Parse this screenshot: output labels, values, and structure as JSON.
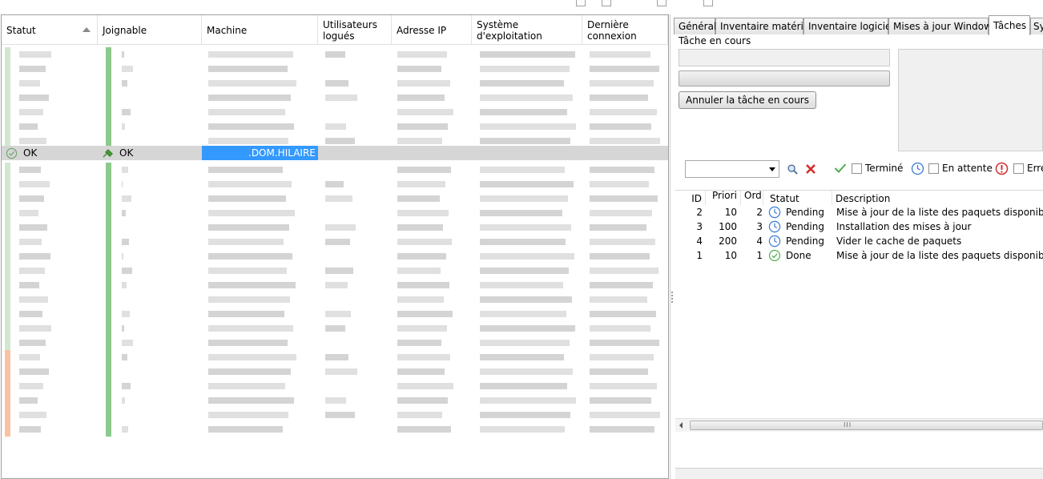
{
  "left_grid": {
    "columns": {
      "statut": "Statut",
      "joignable": "Joignable",
      "machine": "Machine",
      "utilisateurs": "Utilisateurs logués",
      "adresse_ip": "Adresse IP",
      "os": "Système d'exploitation",
      "derniere_connexion": "Dernière connexion"
    },
    "selected_row": {
      "statut": "OK",
      "joignable": "OK",
      "machine": ".DOM.HILAIRE"
    }
  },
  "tabs": [
    "Général",
    "Inventaire matériel",
    "Inventaire logiciel",
    "Mises à jour Windows",
    "Tâches",
    "Sy"
  ],
  "active_tab": "Tâches",
  "task_panel": {
    "current_task_label": "Tâche en cours",
    "cancel_button": "Annuler la tâche en cours"
  },
  "filters": {
    "done_label": "Terminé",
    "pending_label": "En attente",
    "error_label": "Erre"
  },
  "tasks_table": {
    "columns": {
      "id": "ID",
      "priority": "Priori",
      "order": "Ord",
      "status": "Statut",
      "description": "Description"
    },
    "rows": [
      {
        "id": "2",
        "priority": "10",
        "order": "2",
        "status": "Pending",
        "status_icon": "clock-icon",
        "description": "Mise à jour de la liste des paquets disponibles"
      },
      {
        "id": "3",
        "priority": "100",
        "order": "3",
        "status": "Pending",
        "status_icon": "clock-icon",
        "description": "Installation des mises à jour"
      },
      {
        "id": "4",
        "priority": "200",
        "order": "4",
        "status": "Pending",
        "status_icon": "clock-icon",
        "description": "Vider le cache de paquets"
      },
      {
        "id": "1",
        "priority": "10",
        "order": "1",
        "status": "Done",
        "status_icon": "check-circle-icon",
        "description": "Mise à jour de la liste des paquets disponibles"
      }
    ]
  },
  "colors": {
    "selection_blue": "#3399ff",
    "ok_green": "#4caf50",
    "pending_blue": "#3a7bd5",
    "error_red": "#d32f2f",
    "warning_orange": "#f6a77a"
  }
}
